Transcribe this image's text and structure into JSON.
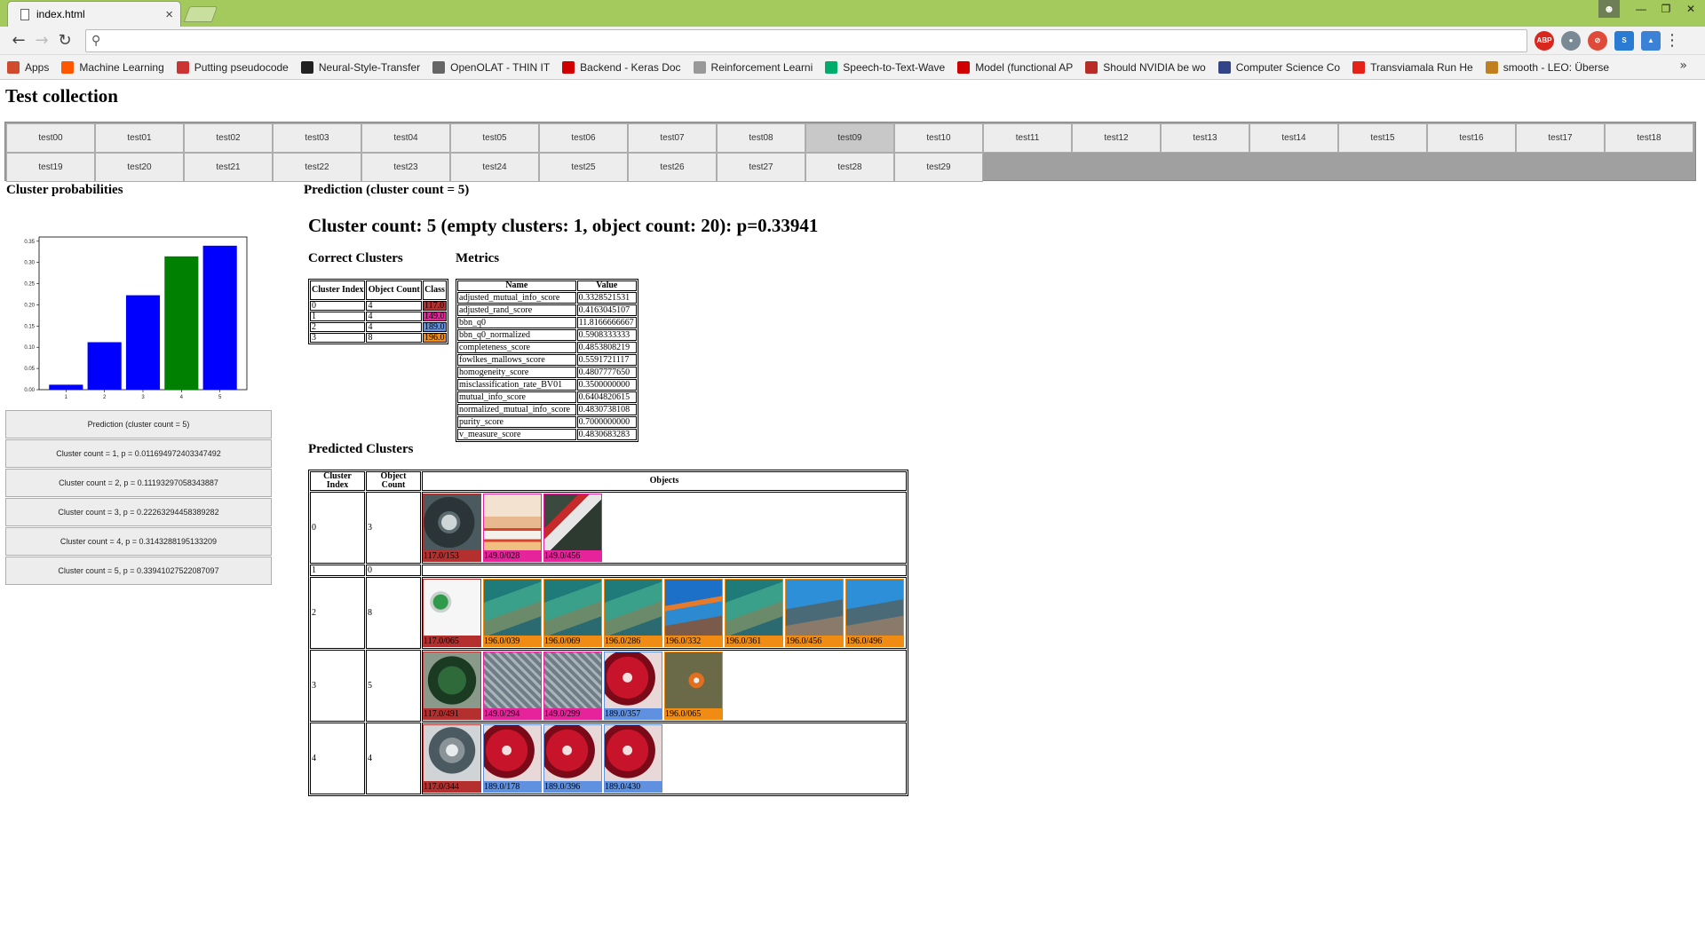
{
  "browser": {
    "tab_title": "index.html",
    "tab_close": "×",
    "bookmarks": [
      {
        "icon": "apps-grid-icon",
        "label": "Apps",
        "color": "#d04a2c"
      },
      {
        "icon": "reddit-icon",
        "label": "Machine Learning",
        "color": "#ff5700"
      },
      {
        "icon": "braces-icon",
        "label": "Putting pseudocode",
        "color": "#cc3333"
      },
      {
        "icon": "github-icon",
        "label": "Neural-Style-Transfer",
        "color": "#222222"
      },
      {
        "icon": "openolat-icon",
        "label": "OpenOLAT - THIN IT",
        "color": "#666666"
      },
      {
        "icon": "keras-icon",
        "label": "Backend - Keras Doc",
        "color": "#d00000"
      },
      {
        "icon": "page-icon",
        "label": "Reinforcement Learni",
        "color": "#999999"
      },
      {
        "icon": "medium-icon",
        "label": "Speech-to-Text-Wave",
        "color": "#00ab6c"
      },
      {
        "icon": "keras-icon",
        "label": "Model (functional AP",
        "color": "#d00000"
      },
      {
        "icon": "quora-icon",
        "label": "Should NVIDIA be wo",
        "color": "#b92b27"
      },
      {
        "icon": "lipn-icon",
        "label": "Computer Science Co",
        "color": "#334488"
      },
      {
        "icon": "youtube-icon",
        "label": "Transviamala Run He",
        "color": "#e62117"
      },
      {
        "icon": "leo-icon",
        "label": "smooth - LEO: Überse",
        "color": "#c08020"
      }
    ],
    "bookmarks_more": "»"
  },
  "page": {
    "title": "Test collection",
    "tests": [
      "test00",
      "test01",
      "test02",
      "test03",
      "test04",
      "test05",
      "test06",
      "test07",
      "test08",
      "test09",
      "test10",
      "test11",
      "test12",
      "test13",
      "test14",
      "test15",
      "test16",
      "test17",
      "test18",
      "test19",
      "test20",
      "test21",
      "test22",
      "test23",
      "test24",
      "test25",
      "test26",
      "test27",
      "test28",
      "test29"
    ],
    "selected_test": "test09",
    "cluster_prob_heading": "Cluster probabilities",
    "prediction_heading": "Prediction (cluster count = 5)",
    "summary": "Cluster count: 5 (empty clusters: 1, object count: 20): p=0.33941",
    "prediction_buttons": [
      "Prediction (cluster count = 5)",
      "Cluster count = 1, p = 0.011694972403347492",
      "Cluster count = 2, p = 0.11193297058343887",
      "Cluster count = 3, p = 0.22263294458389282",
      "Cluster count = 4, p = 0.3143288195133209",
      "Cluster count = 5, p = 0.33941027522087097"
    ],
    "correct_clusters": {
      "heading": "Correct Clusters",
      "headers": [
        "Cluster Index",
        "Object Count",
        "Class"
      ],
      "rows": [
        {
          "index": "0",
          "count": "4",
          "class": "117.0",
          "color": "#b4302f"
        },
        {
          "index": "1",
          "count": "4",
          "class": "149.0",
          "color": "#e6239a"
        },
        {
          "index": "2",
          "count": "4",
          "class": "189.0",
          "color": "#5f91e0"
        },
        {
          "index": "3",
          "count": "8",
          "class": "196.0",
          "color": "#f08c14"
        }
      ]
    },
    "metrics": {
      "heading": "Metrics",
      "headers": [
        "Name",
        "Value"
      ],
      "rows": [
        [
          "adjusted_mutual_info_score",
          "0.3328521531"
        ],
        [
          "adjusted_rand_score",
          "0.4163045107"
        ],
        [
          "bbn_q0",
          "11.8166666667"
        ],
        [
          "bbn_q0_normalized",
          "0.5908333333"
        ],
        [
          "completeness_score",
          "0.4853808219"
        ],
        [
          "fowlkes_mallows_score",
          "0.5591721117"
        ],
        [
          "homogeneity_score",
          "0.4807777650"
        ],
        [
          "misclassification_rate_BV01",
          "0.3500000000"
        ],
        [
          "mutual_info_score",
          "0.6404820615"
        ],
        [
          "normalized_mutual_info_score",
          "0.4830738108"
        ],
        [
          "purity_score",
          "0.7000000000"
        ],
        [
          "v_measure_score",
          "0.4830683283"
        ]
      ]
    },
    "predicted_clusters": {
      "heading": "Predicted Clusters",
      "headers": [
        "Cluster Index",
        "Object Count",
        "Objects"
      ],
      "class_colors": {
        "117.0": "#b4302f",
        "149.0": "#e6239a",
        "189.0": "#5f91e0",
        "196.0": "#f08c14"
      },
      "rows": [
        {
          "index": "0",
          "count": "3",
          "objects": [
            {
              "label": "117.0/153",
              "cls": "117.0",
              "img": "watch-image"
            },
            {
              "label": "149.0/028",
              "cls": "149.0",
              "img": "girl-stockings-image"
            },
            {
              "label": "149.0/456",
              "cls": "149.0",
              "img": "boots-image"
            }
          ]
        },
        {
          "index": "1",
          "count": "0",
          "objects": []
        },
        {
          "index": "2",
          "count": "8",
          "objects": [
            {
              "label": "117.0/065",
              "cls": "117.0",
              "img": "green-ring-image"
            },
            {
              "label": "196.0/039",
              "cls": "196.0",
              "img": "coral-image"
            },
            {
              "label": "196.0/069",
              "cls": "196.0",
              "img": "coral-image"
            },
            {
              "label": "196.0/286",
              "cls": "196.0",
              "img": "coral-image"
            },
            {
              "label": "196.0/332",
              "cls": "196.0",
              "img": "reef-fish-image"
            },
            {
              "label": "196.0/361",
              "cls": "196.0",
              "img": "coral-image"
            },
            {
              "label": "196.0/456",
              "cls": "196.0",
              "img": "reef-image"
            },
            {
              "label": "196.0/496",
              "cls": "196.0",
              "img": "reef-image"
            }
          ]
        },
        {
          "index": "3",
          "count": "5",
          "objects": [
            {
              "label": "117.0/491",
              "cls": "117.0",
              "img": "green-cube-image"
            },
            {
              "label": "149.0/294",
              "cls": "149.0",
              "img": "lace-tights-image"
            },
            {
              "label": "149.0/299",
              "cls": "149.0",
              "img": "lace-tights-image"
            },
            {
              "label": "189.0/357",
              "cls": "189.0",
              "img": "pomegranate-image"
            },
            {
              "label": "196.0/065",
              "cls": "196.0",
              "img": "clownfish-image"
            }
          ]
        },
        {
          "index": "4",
          "count": "4",
          "objects": [
            {
              "label": "117.0/344",
              "cls": "117.0",
              "img": "silver-ring-image"
            },
            {
              "label": "189.0/178",
              "cls": "189.0",
              "img": "pomegranate-image"
            },
            {
              "label": "189.0/396",
              "cls": "189.0",
              "img": "pomegranate-image"
            },
            {
              "label": "189.0/430",
              "cls": "189.0",
              "img": "pomegranate-image"
            }
          ]
        }
      ]
    }
  },
  "chart_data": {
    "type": "bar",
    "categories": [
      "1",
      "2",
      "3",
      "4",
      "5"
    ],
    "values": [
      0.011694972403347492,
      0.11193297058343887,
      0.22263294458389282,
      0.3143288195133209,
      0.33941027522087097
    ],
    "colors": [
      "#0000ff",
      "#0000ff",
      "#0000ff",
      "#008000",
      "#0000ff"
    ],
    "yticks": [
      "0.00",
      "0.05",
      "0.10",
      "0.15",
      "0.20",
      "0.25",
      "0.30",
      "0.35"
    ],
    "ylim": [
      0,
      0.36
    ],
    "grid": false
  }
}
